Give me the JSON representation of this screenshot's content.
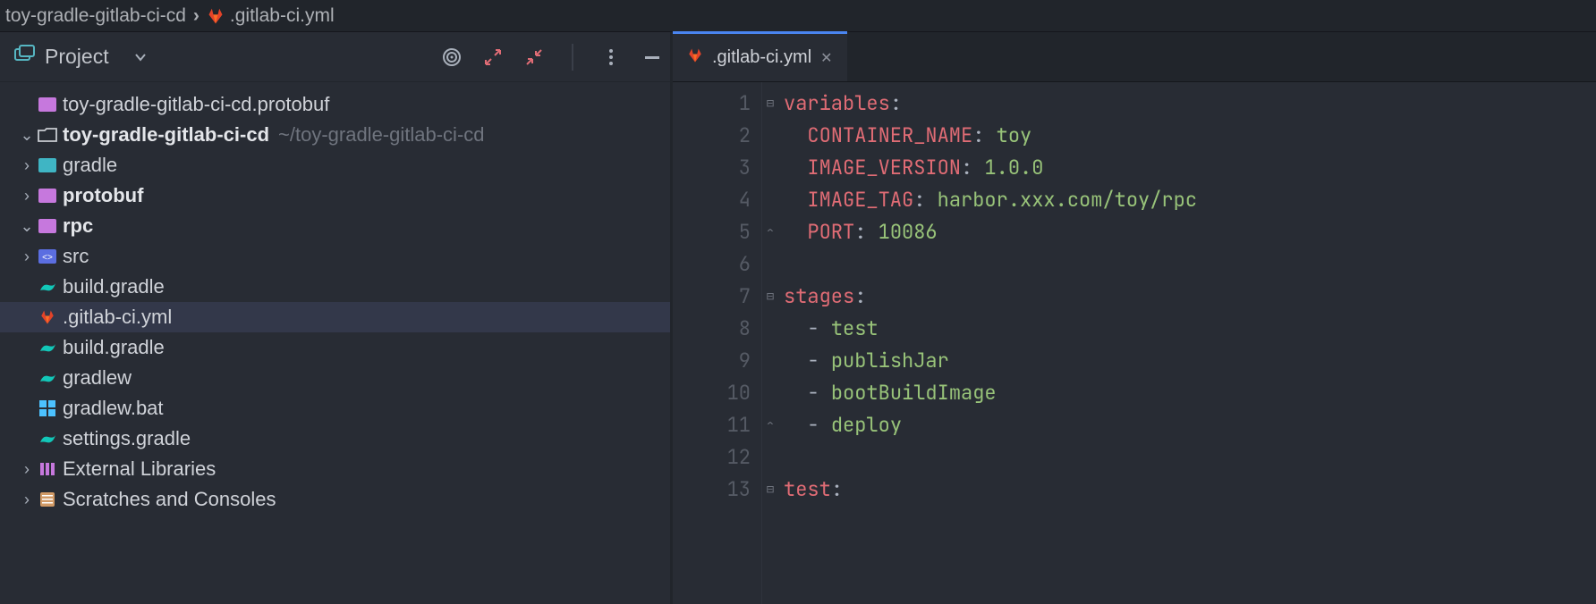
{
  "breadcrumb": {
    "root": "toy-gradle-gitlab-ci-cd",
    "file": ".gitlab-ci.yml"
  },
  "project_panel": {
    "title": "Project"
  },
  "tree": {
    "protobuf_mod": "toy-gradle-gitlab-ci-cd.protobuf",
    "root": "toy-gradle-gitlab-ci-cd",
    "root_path": "~/toy-gradle-gitlab-ci-cd",
    "gradle": "gradle",
    "protobuf": "protobuf",
    "rpc": "rpc",
    "src": "src",
    "build_gradle_inner": "build.gradle",
    "gitlab_ci": ".gitlab-ci.yml",
    "build_gradle": "build.gradle",
    "gradlew": "gradlew",
    "gradlew_bat": "gradlew.bat",
    "settings_gradle": "settings.gradle",
    "external_libs": "External Libraries",
    "scratches": "Scratches and Consoles"
  },
  "tab": {
    "name": ".gitlab-ci.yml"
  },
  "code": {
    "l1_key": "variables",
    "l2_key": "CONTAINER_NAME",
    "l2_val": "toy",
    "l3_key": "IMAGE_VERSION",
    "l3_val": "1.0.0",
    "l4_key": "IMAGE_TAG",
    "l4_val": "harbor.xxx.com/toy/rpc",
    "l5_key": "PORT",
    "l5_val": "10086",
    "l7_key": "stages",
    "l8_val": "test",
    "l9_val": "publishJar",
    "l10_val": "bootBuildImage",
    "l11_val": "deploy",
    "l13_key": "test"
  },
  "line_numbers": [
    "1",
    "2",
    "3",
    "4",
    "5",
    "6",
    "7",
    "8",
    "9",
    "10",
    "11",
    "12",
    "13"
  ]
}
